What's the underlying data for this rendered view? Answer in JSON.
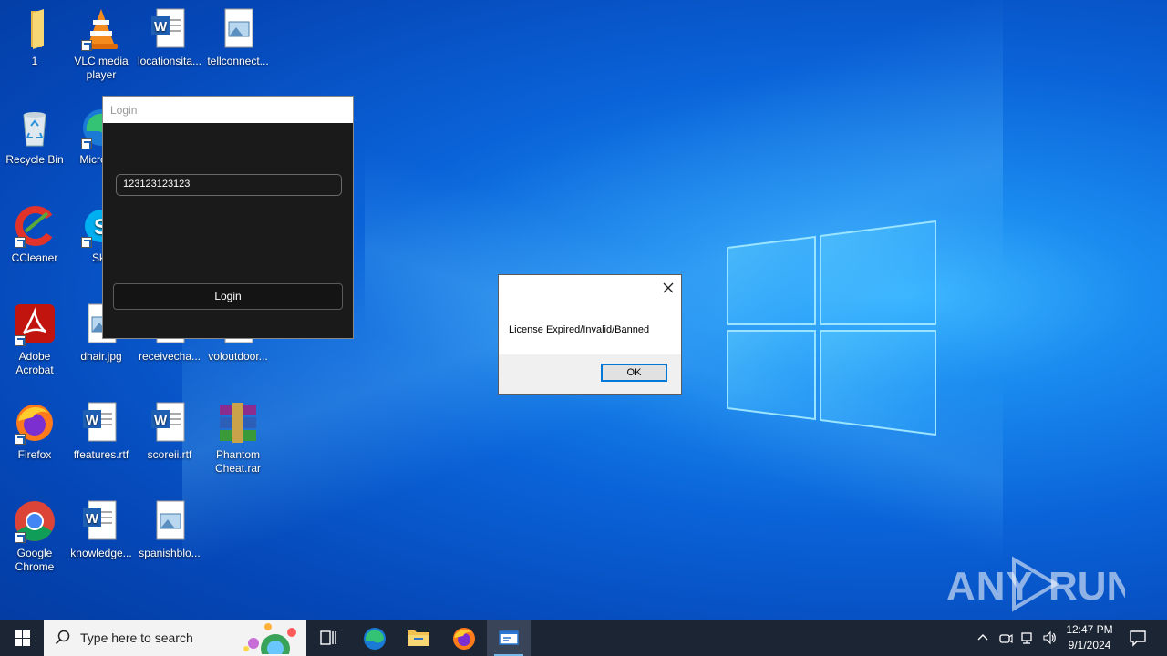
{
  "desktop": {
    "icons": [
      {
        "label": "1"
      },
      {
        "label": "VLC media player"
      },
      {
        "label": "locationsita..."
      },
      {
        "label": "tellconnect..."
      },
      {
        "label": "Recycle Bin"
      },
      {
        "label": "Micro Ed"
      },
      {
        "label": "CCleaner"
      },
      {
        "label": "Sky"
      },
      {
        "label": "Adobe Acrobat"
      },
      {
        "label": "dhair.jpg"
      },
      {
        "label": "receivecha..."
      },
      {
        "label": "voloutdoor..."
      },
      {
        "label": "Firefox"
      },
      {
        "label": "ffeatures.rtf"
      },
      {
        "label": "scoreii.rtf"
      },
      {
        "label": "Phantom Cheat.rar"
      },
      {
        "label": "Google Chrome"
      },
      {
        "label": "knowledge..."
      },
      {
        "label": "spanishblo..."
      }
    ]
  },
  "login_window": {
    "title": "Login",
    "key_value": "123123123123",
    "login_label": "Login"
  },
  "message_box": {
    "text": "License Expired/Invalid/Banned",
    "ok_label": "OK"
  },
  "watermark": {
    "text": "ANY RUN"
  },
  "taskbar": {
    "search_placeholder": "Type here to search",
    "time": "12:47 PM",
    "date": "9/1/2024"
  },
  "colors": {
    "taskbar_bg": "#1c2534",
    "accent": "#0078d7",
    "login_bg": "#1a1a1a"
  }
}
